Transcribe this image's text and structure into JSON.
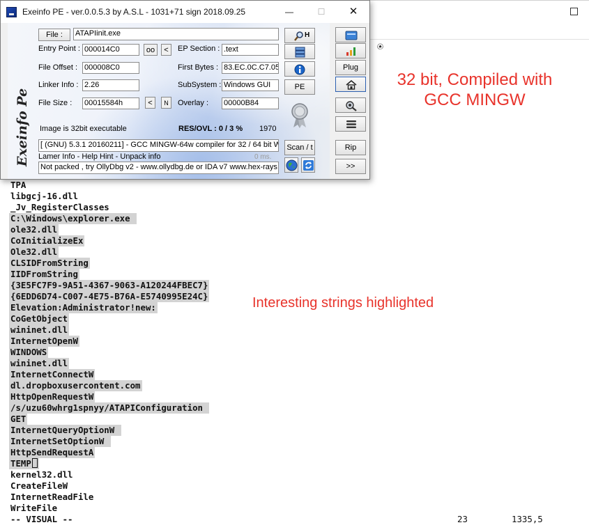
{
  "exeinfo": {
    "title": "Exeinfo PE - ver.0.0.5.3  by A.S.L -  1031+71 sign  2018.09.25",
    "window_buttons": {
      "minimize": "—",
      "maximize": "☐",
      "close": "✕"
    },
    "file_button": "File :",
    "file_name": "ATAPIinit.exe",
    "search_button": "H",
    "entry_point_label": "Entry Point :",
    "entry_point_value": "000014C0",
    "oo_button": "oo",
    "prev_button": "<",
    "ep_section_label": "EP Section :",
    "ep_section_value": ".text",
    "file_offset_label": "File Offset :",
    "file_offset_value": "000008C0",
    "first_bytes_label": "First Bytes :",
    "first_bytes_value": "83.EC.0C.C7.05",
    "linker_info_label": "Linker Info :",
    "linker_info_value": "2.26",
    "subsystem_label": "SubSystem :",
    "subsystem_value": "Windows GUI",
    "pe_button": "PE",
    "file_size_label": "File Size :",
    "file_size_value": "00015584h",
    "size_prev_button": "<",
    "size_n_button": "N",
    "overlay_label": "Overlay :",
    "overlay_value": "00000B84",
    "image_info": "Image is 32bit executable",
    "res_ovl": "RES/OVL : 0 / 3 %",
    "year": "1970",
    "detection": "[ (GNU) 5.3.1 20160211] - GCC MINGW-64w compiler for 32 / 64 bit W",
    "scan_button": "Scan / t",
    "lamer_info": "Lamer Info - Help Hint - Unpack info",
    "timing": "0 ms.",
    "unpack_hint": "Not packed , try OllyDbg v2 - www.ollydbg.de or IDA v7 www.hex-rays",
    "plug_button": "Plug",
    "rip_button": "Rip",
    "next_button": ">>",
    "logo_text": "Exeinfo Pe"
  },
  "terminal": {
    "lines": [
      {
        "text": "TPA",
        "hl": false
      },
      {
        "text": "libgcj-16.dll",
        "hl": false
      },
      {
        "text": "_Jv_RegisterClasses",
        "hl": false
      },
      {
        "text": "C:\\Windows\\explorer.exe ",
        "hl": true
      },
      {
        "text": "ole32.dll",
        "hl": true
      },
      {
        "text": "CoInitializeEx",
        "hl": true
      },
      {
        "text": "Ole32.dll",
        "hl": true
      },
      {
        "text": "CLSIDFromString",
        "hl": true
      },
      {
        "text": "IIDFromString",
        "hl": true
      },
      {
        "text": "{3E5FC7F9-9A51-4367-9063-A120244FBEC7}",
        "hl": true
      },
      {
        "text": "{6EDD6D74-C007-4E75-B76A-E5740995E24C}",
        "hl": true
      },
      {
        "text": "Elevation:Administrator!new:",
        "hl": true
      },
      {
        "text": "CoGetObject",
        "hl": true
      },
      {
        "text": "wininet.dll",
        "hl": true
      },
      {
        "text": "InternetOpenW",
        "hl": true
      },
      {
        "text": "WINDOWS",
        "hl": true
      },
      {
        "text": "wininet.dll",
        "hl": true
      },
      {
        "text": "InternetConnectW",
        "hl": true
      },
      {
        "text": "dl.dropboxusercontent.com",
        "hl": true
      },
      {
        "text": "HttpOpenRequestW",
        "hl": true
      },
      {
        "text": "/s/uzu60whrg1spnyy/ATAPIConfiguration ",
        "hl": true
      },
      {
        "text": "GET",
        "hl": true
      },
      {
        "text": "InternetQueryOptionW ",
        "hl": true
      },
      {
        "text": "InternetSetOptionW ",
        "hl": true
      },
      {
        "text": "HttpSendRequestA",
        "hl": true
      },
      {
        "text": "TEMP",
        "hl": true
      },
      {
        "text": "kernel32.dll",
        "hl": false
      },
      {
        "text": "CreateFileW",
        "hl": false
      },
      {
        "text": "InternetReadFile",
        "hl": false
      },
      {
        "text": "WriteFile",
        "hl": false
      }
    ],
    "status_mode": "-- VISUAL --",
    "status_col": "23",
    "status_pos": "1335,5"
  },
  "annotations": {
    "compiler": "32 bit, Compiled with GCC MINGW",
    "strings": "Interesting strings highlighted"
  },
  "icons": [
    "app-icon",
    "magnifier-icon",
    "stack-icon",
    "info-icon",
    "seal-icon",
    "folder-icon",
    "bar-chart-icon",
    "home-icon",
    "tools-icon",
    "menu-icon",
    "globe-icon",
    "refresh-icon",
    "cursor-icon"
  ],
  "colors": {
    "annotation": "#e8332b",
    "highlight": "#d3d3d3"
  }
}
